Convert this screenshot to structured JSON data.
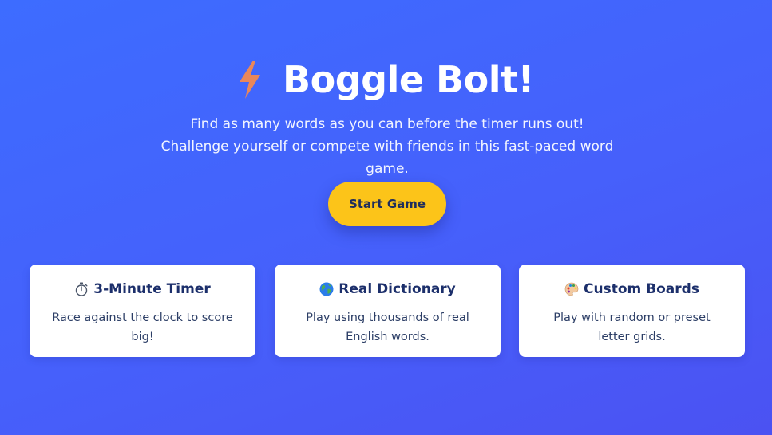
{
  "header": {
    "icon": "lightning-bolt-icon",
    "title": "Boggle Bolt!",
    "subtitle": "Find as many words as you can before the timer runs out! Challenge yourself or compete with friends in this fast-paced word game."
  },
  "cta": {
    "start_label": "Start Game"
  },
  "features": [
    {
      "icon": "stopwatch-icon",
      "title": "3-Minute Timer",
      "description": "Race against the clock to score big!"
    },
    {
      "icon": "globe-icon",
      "title": "Real Dictionary",
      "description": "Play using thousands of real English words."
    },
    {
      "icon": "palette-icon",
      "title": "Custom Boards",
      "description": "Play with random or preset letter grids."
    }
  ],
  "colors": {
    "background_start": "#3d6cff",
    "background_end": "#4b52f2",
    "button": "#fcc419",
    "bolt": "#e8875a",
    "card_text": "#1c2f6b"
  }
}
